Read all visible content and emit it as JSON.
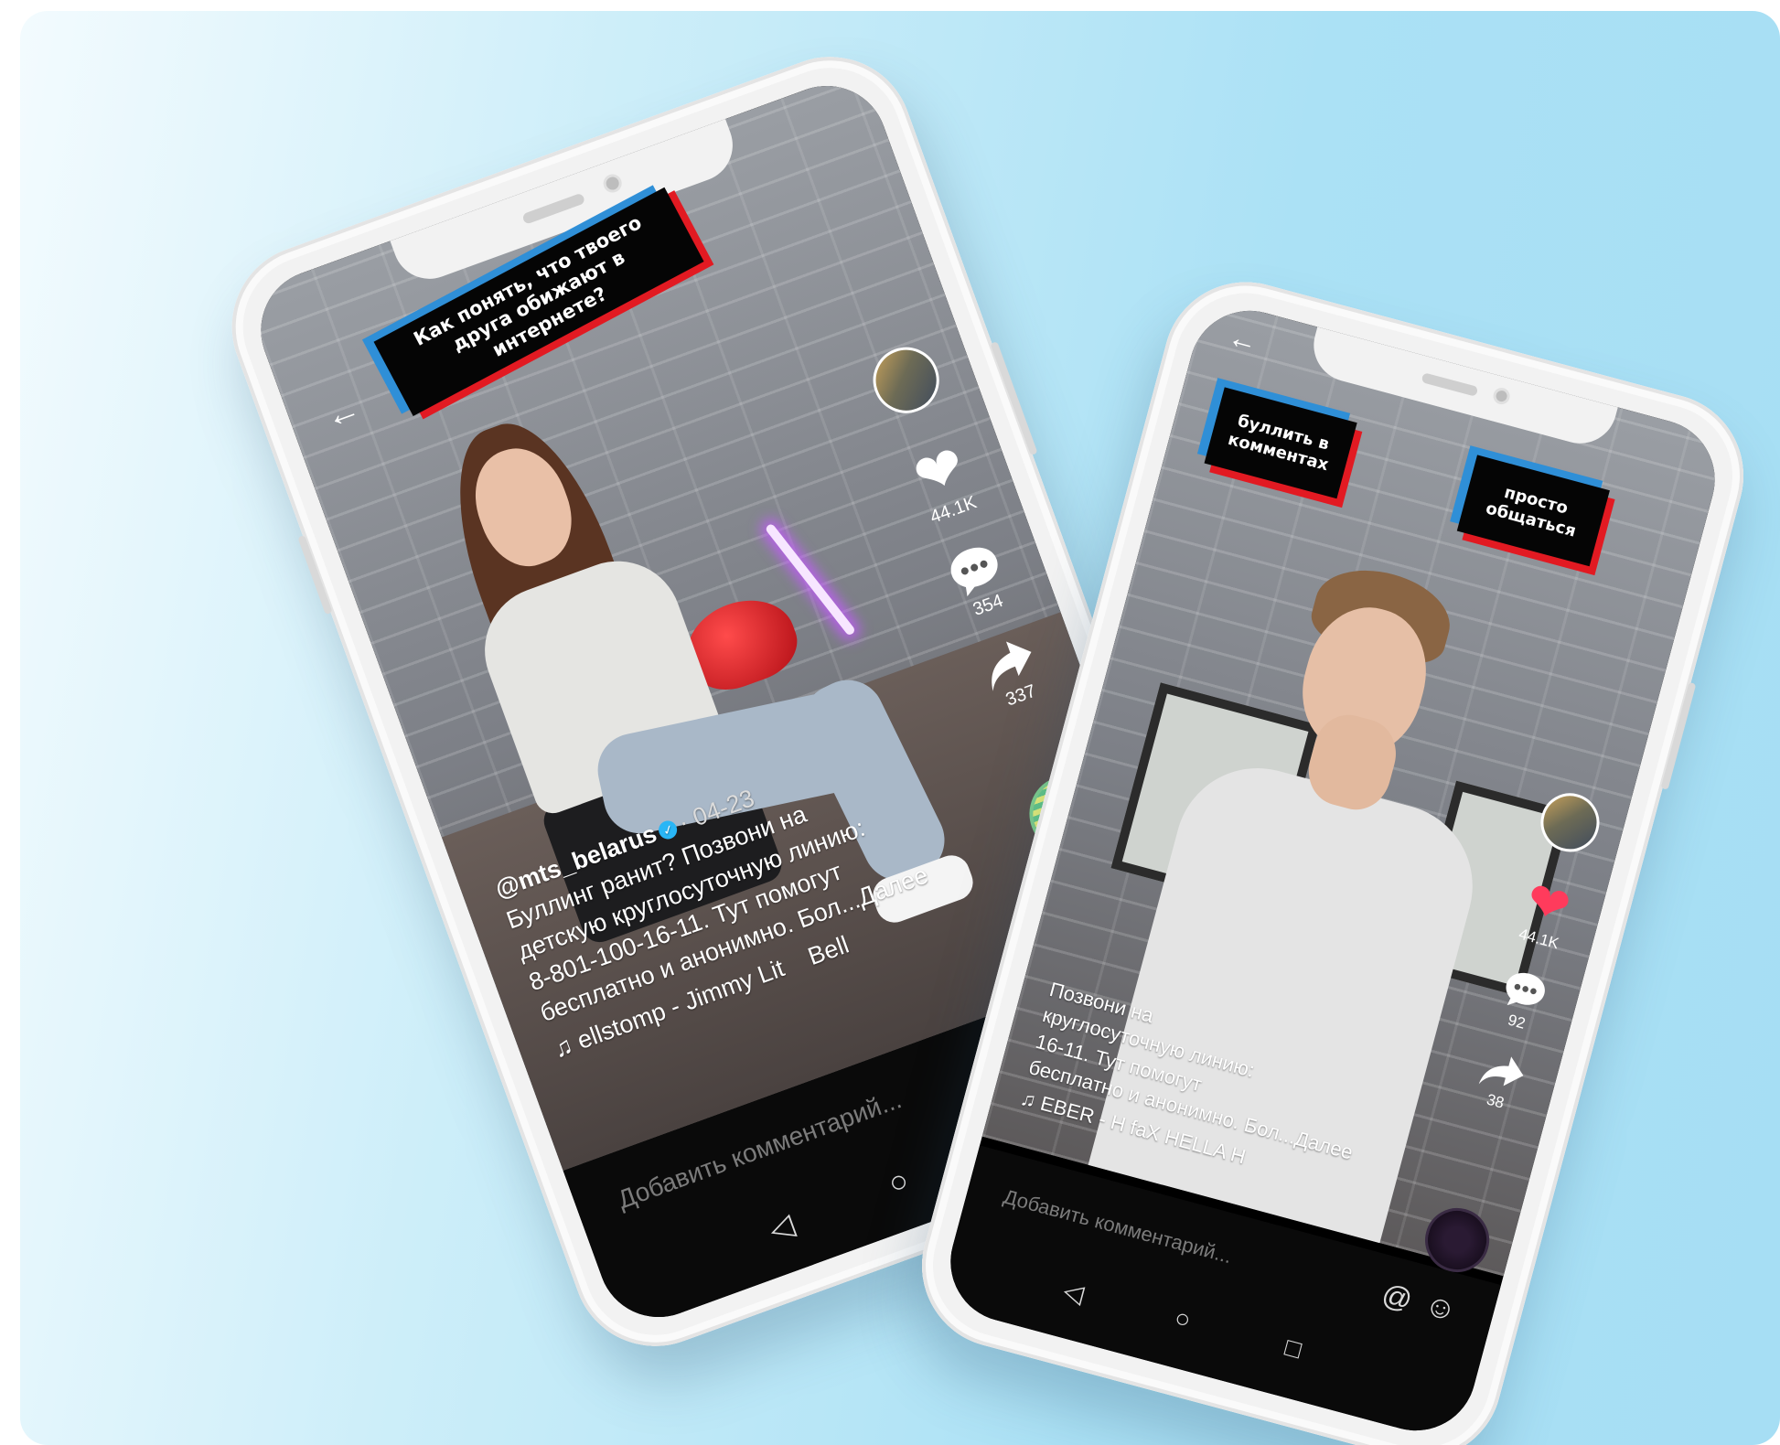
{
  "phone_left": {
    "banner_text": "Как понять, что твоего друга обижают в интернете?",
    "back_icon": "arrow-left-icon",
    "likes": "44.1K",
    "comments": "354",
    "shares": "337",
    "handle": "@mts_belarus",
    "date": "· 04-23",
    "caption_lines": [
      "Буллинг ранит? Позвони на",
      "детскую круглосуточную линию:",
      "8-801-100-16-11. Тут помогут",
      "бесплатно и анонимно. Бол...Далее"
    ],
    "music": "ellstomp - Jimmy Lit",
    "music_extra": "Bell",
    "comment_placeholder": "Добавить комментарий...",
    "at_symbol": "@",
    "nav": {
      "back": "◁",
      "home": "○",
      "recent": "□"
    }
  },
  "phone_right": {
    "option_left": "буллить в комментах",
    "option_right": "просто общаться",
    "likes": "44.1K",
    "comments": "92",
    "shares": "38",
    "caption_lines": [
      "Позвони на",
      "круглосуточную линию:",
      "16-11. Тут помогут",
      "бесплатно и анонимно. Бол...Далее"
    ],
    "music": "EBER - H   faX   HELLA  Н",
    "comment_placeholder": "Добавить комментарий...",
    "at_symbol": "@",
    "nav": {
      "back": "◁",
      "home": "○",
      "recent": "□"
    }
  },
  "colors": {
    "accent_red": "#e21a22",
    "accent_blue": "#2f8fd7",
    "like_red": "#ff3b5c"
  }
}
